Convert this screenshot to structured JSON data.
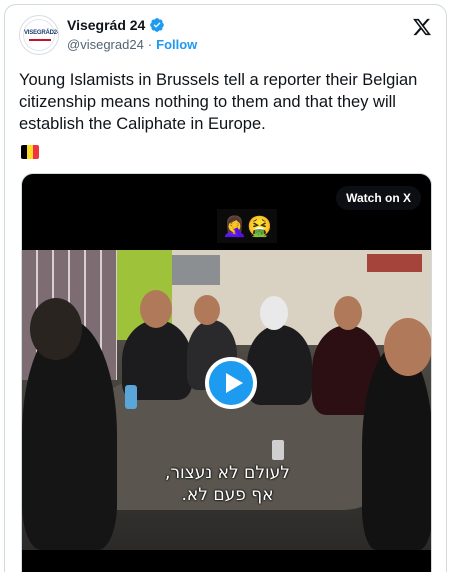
{
  "author": {
    "display_name": "Visegrád 24",
    "handle": "@visegrad24",
    "separator": "·",
    "follow_label": "Follow",
    "avatar_text": "VISEGRÁD24"
  },
  "tweet": {
    "text": "Young Islamists in Brussels tell a reporter their Belgian citizenship means nothing to them and that they will establish the Caliphate in Europe.",
    "flag_colors": [
      "#000000",
      "#fdda24",
      "#ef3340"
    ]
  },
  "media": {
    "watch_label": "Watch on X",
    "emoji_overlay": "🤦‍♀️🤮",
    "subtitle_line1": "לעולם לא נעצור,",
    "subtitle_line2": "אף פעם לא."
  },
  "icons": {
    "verified": "verified-badge-icon",
    "brand": "x-logo-icon",
    "play": "play-icon"
  },
  "colors": {
    "accent": "#1d9bf0",
    "text": "#0f1419",
    "muted": "#536471"
  }
}
